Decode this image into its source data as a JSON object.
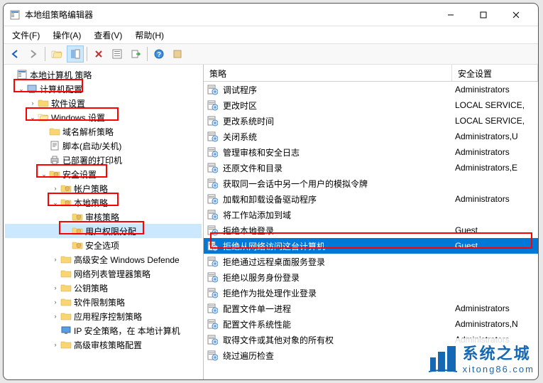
{
  "window": {
    "title": "本地组策略编辑器"
  },
  "menus": [
    "文件(F)",
    "操作(A)",
    "查看(V)",
    "帮助(H)"
  ],
  "tree": {
    "root": "本地计算机 策略",
    "computer_config": "计算机配置",
    "software_settings": "软件设置",
    "windows_settings": "Windows 设置",
    "dns_policy": "域名解析策略",
    "scripts": "脚本(启动/关机)",
    "deployed_printers": "已部署的打印机",
    "security_settings": "安全设置",
    "account_policies": "帐户策略",
    "local_policies": "本地策略",
    "audit_policy": "审核策略",
    "user_rights": "用户权限分配",
    "security_options": "安全选项",
    "windows_defender": "高级安全 Windows Defende",
    "network_list": "网络列表管理器策略",
    "public_key": "公钥策略",
    "software_restrict": "软件限制策略",
    "app_control": "应用程序控制策略",
    "ip_security": "IP 安全策略，在 本地计算机",
    "advanced_audit": "高级审核策略配置"
  },
  "list": {
    "header_policy": "策略",
    "header_setting": "安全设置",
    "rows": [
      {
        "policy": "调试程序",
        "setting": "Administrators"
      },
      {
        "policy": "更改时区",
        "setting": "LOCAL SERVICE,"
      },
      {
        "policy": "更改系统时间",
        "setting": "LOCAL SERVICE,"
      },
      {
        "policy": "关闭系统",
        "setting": "Administrators,U"
      },
      {
        "policy": "管理审核和安全日志",
        "setting": "Administrators"
      },
      {
        "policy": "还原文件和目录",
        "setting": "Administrators,E"
      },
      {
        "policy": "获取同一会话中另一个用户的模拟令牌",
        "setting": ""
      },
      {
        "policy": "加载和卸载设备驱动程序",
        "setting": "Administrators"
      },
      {
        "policy": "将工作站添加到域",
        "setting": ""
      },
      {
        "policy": "拒绝本地登录",
        "setting": "Guest"
      },
      {
        "policy": "拒绝从网络访问这台计算机",
        "setting": "Guest",
        "selected": true
      },
      {
        "policy": "拒绝通过远程桌面服务登录",
        "setting": ""
      },
      {
        "policy": "拒绝以服务身份登录",
        "setting": ""
      },
      {
        "policy": "拒绝作为批处理作业登录",
        "setting": ""
      },
      {
        "policy": "配置文件单一进程",
        "setting": "Administrators"
      },
      {
        "policy": "配置文件系统性能",
        "setting": "Administrators,N"
      },
      {
        "policy": "取得文件或其他对象的所有权",
        "setting": "Administrators"
      },
      {
        "policy": "绕过遍历检查",
        "setting": ""
      }
    ]
  },
  "watermark": {
    "main": "系统之城",
    "sub": "xitong86.com"
  }
}
